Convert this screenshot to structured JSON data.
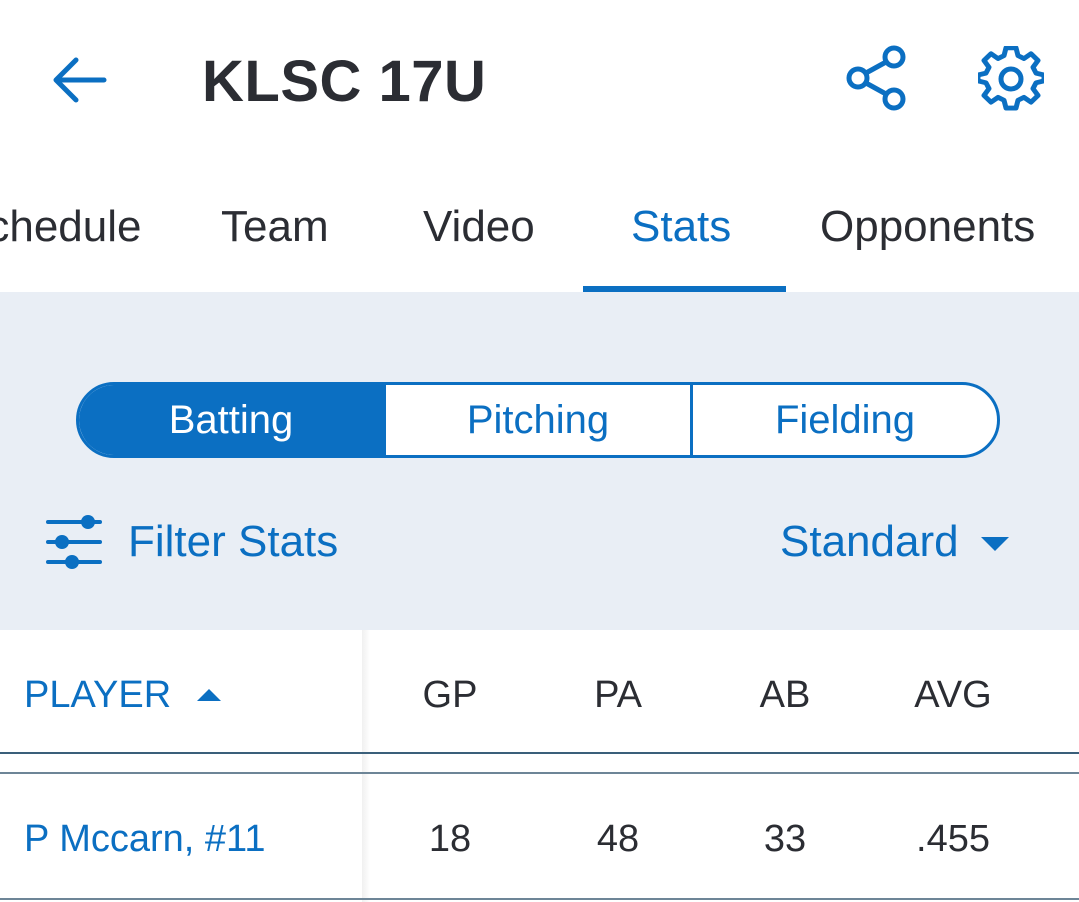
{
  "header": {
    "title": "KLSC 17U",
    "back_icon": "arrow-left-icon",
    "share_icon": "share-icon",
    "settings_icon": "gear-icon"
  },
  "tabs": [
    {
      "label": "Schedule",
      "active": false
    },
    {
      "label": "Team",
      "active": false
    },
    {
      "label": "Video",
      "active": false
    },
    {
      "label": "Stats",
      "active": true
    },
    {
      "label": "Opponents",
      "active": false
    }
  ],
  "stat_types": [
    {
      "label": "Batting",
      "active": true
    },
    {
      "label": "Pitching",
      "active": false
    },
    {
      "label": "Fielding",
      "active": false
    }
  ],
  "filter": {
    "label": "Filter Stats",
    "icon": "sliders-icon"
  },
  "view_select": {
    "value": "Standard",
    "icon": "caret-down-icon"
  },
  "table": {
    "columns": [
      "PLAYER",
      "GP",
      "PA",
      "AB",
      "AVG"
    ],
    "sort_icon": "caret-up-icon",
    "rows": [
      {
        "player": "P Mccarn, #11",
        "gp": "18",
        "pa": "48",
        "ab": "33",
        "avg": ".455"
      }
    ]
  },
  "colors": {
    "accent": "#0b6fc2",
    "text": "#2b2d33",
    "panel_bg": "#e9eef5"
  }
}
